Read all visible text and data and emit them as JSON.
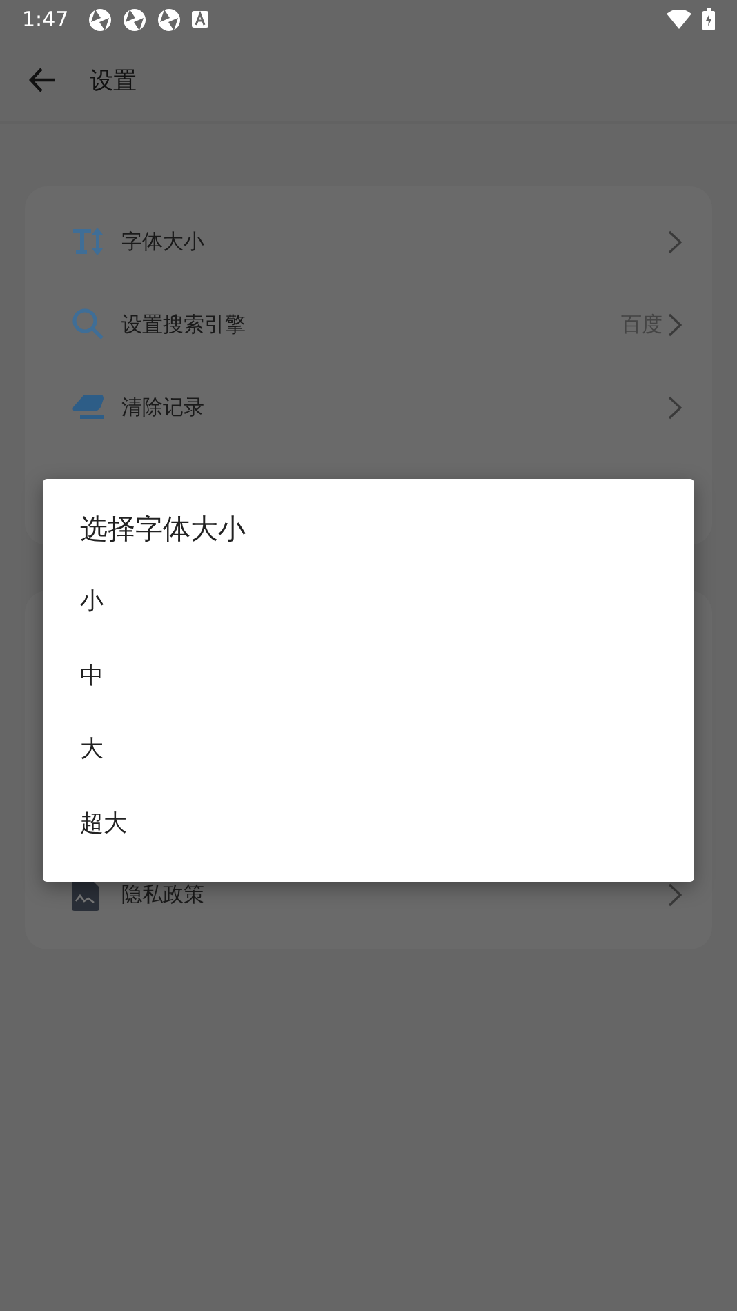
{
  "status_bar": {
    "time": "1:47"
  },
  "app_bar": {
    "title": "设置"
  },
  "cards": [
    {
      "items": [
        {
          "kind": "fontsize",
          "label": "字体大小"
        },
        {
          "kind": "search",
          "label": "设置搜索引擎",
          "value": "百度"
        },
        {
          "kind": "eraser",
          "label": "清除记录"
        }
      ]
    },
    {
      "items": [
        {
          "kind": "document",
          "label": "隐私政策"
        }
      ]
    }
  ],
  "dialog": {
    "title": "选择字体大小",
    "options": [
      "小",
      "中",
      "大",
      "超大"
    ]
  }
}
